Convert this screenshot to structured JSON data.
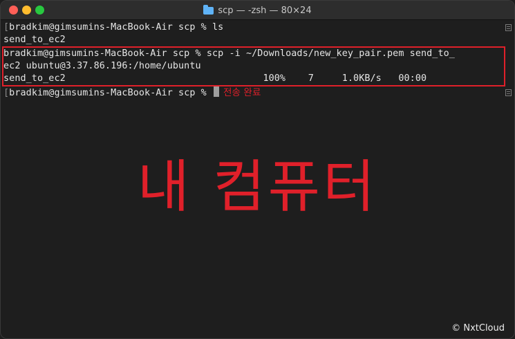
{
  "window": {
    "title": "scp — -zsh — 80×24"
  },
  "terminal": {
    "lines": [
      "bradkim@gimsumins-MacBook-Air scp % ls",
      "send_to_ec2",
      "bradkim@gimsumins-MacBook-Air scp % scp -i ~/Downloads/new_key_pair.pem send_to_",
      "ec2 ubuntu@3.37.86.196:/home/ubuntu",
      "send_to_ec2                                   100%    7     1.0KB/s   00:00",
      "bradkim@gimsumins-MacBook-Air scp % "
    ]
  },
  "annotations": {
    "transfer_done": "전송 완료",
    "big_label": "내 컴퓨터",
    "highlight_color": "#e0202a"
  },
  "watermark": "© NxtCloud",
  "colors": {
    "background": "#1e1e1e",
    "text": "#e6e6e6",
    "accent_red": "#e0202a"
  }
}
